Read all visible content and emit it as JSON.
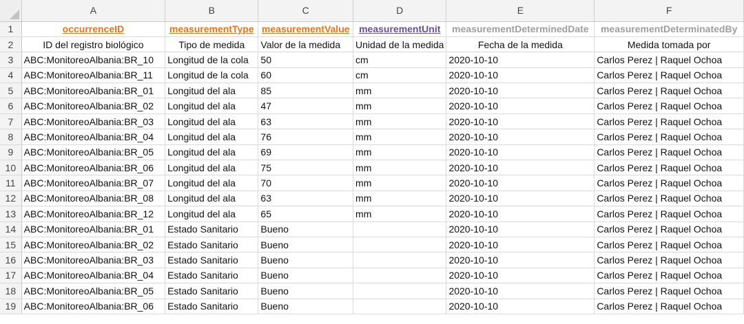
{
  "column_letters": [
    "A",
    "B",
    "C",
    "D",
    "E",
    "F"
  ],
  "header_row": {
    "row_number": "1",
    "cells": [
      {
        "text": "occurrenceID",
        "color": "#e3761f",
        "underline": true
      },
      {
        "text": "measurementType",
        "color": "#e3761f",
        "underline": true
      },
      {
        "text": "measurementValue",
        "color": "#e3761f",
        "underline": true
      },
      {
        "text": "measurementUnit",
        "color": "#6a4f94",
        "underline": true
      },
      {
        "text": "measurementDeterminedDate",
        "color": "#9e9e9e",
        "underline": false
      },
      {
        "text": "measurementDeterminatedBy",
        "color": "#9e9e9e",
        "underline": false
      }
    ]
  },
  "label_row": {
    "row_number": "2",
    "cells": [
      "ID del registro biológico",
      "Tipo de medida",
      "Valor de la medida",
      "Unidad de la medida",
      "Fecha de la medida",
      "Medida tomada por"
    ]
  },
  "rows": [
    {
      "n": "3",
      "cells": [
        "ABC:MonitoreoAlbania:BR_10",
        "Longitud de la cola",
        "50",
        "cm",
        "2020-10-10",
        "Carlos Perez | Raquel Ochoa"
      ]
    },
    {
      "n": "4",
      "cells": [
        "ABC:MonitoreoAlbania:BR_11",
        "Longitud de la cola",
        "60",
        "cm",
        "2020-10-10",
        "Carlos Perez | Raquel Ochoa"
      ]
    },
    {
      "n": "5",
      "cells": [
        "ABC:MonitoreoAlbania:BR_01",
        "Longitud del ala",
        "85",
        "mm",
        "2020-10-10",
        "Carlos Perez | Raquel Ochoa"
      ]
    },
    {
      "n": "6",
      "cells": [
        "ABC:MonitoreoAlbania:BR_02",
        "Longitud del ala",
        "47",
        "mm",
        "2020-10-10",
        "Carlos Perez | Raquel Ochoa"
      ]
    },
    {
      "n": "7",
      "cells": [
        "ABC:MonitoreoAlbania:BR_03",
        "Longitud del ala",
        "63",
        "mm",
        "2020-10-10",
        "Carlos Perez | Raquel Ochoa"
      ]
    },
    {
      "n": "8",
      "cells": [
        "ABC:MonitoreoAlbania:BR_04",
        "Longitud del ala",
        "76",
        "mm",
        "2020-10-10",
        "Carlos Perez | Raquel Ochoa"
      ]
    },
    {
      "n": "9",
      "cells": [
        "ABC:MonitoreoAlbania:BR_05",
        "Longitud del ala",
        "69",
        "mm",
        "2020-10-10",
        "Carlos Perez | Raquel Ochoa"
      ]
    },
    {
      "n": "10",
      "cells": [
        "ABC:MonitoreoAlbania:BR_06",
        "Longitud del ala",
        "75",
        "mm",
        "2020-10-10",
        "Carlos Perez | Raquel Ochoa"
      ]
    },
    {
      "n": "11",
      "cells": [
        "ABC:MonitoreoAlbania:BR_07",
        "Longitud del ala",
        "70",
        "mm",
        "2020-10-10",
        "Carlos Perez | Raquel Ochoa"
      ]
    },
    {
      "n": "12",
      "cells": [
        "ABC:MonitoreoAlbania:BR_08",
        "Longitud del ala",
        "63",
        "mm",
        "2020-10-10",
        "Carlos Perez | Raquel Ochoa"
      ]
    },
    {
      "n": "13",
      "cells": [
        "ABC:MonitoreoAlbania:BR_12",
        "Longitud del ala",
        "65",
        "mm",
        "2020-10-10",
        "Carlos Perez | Raquel Ochoa"
      ]
    },
    {
      "n": "14",
      "cells": [
        "ABC:MonitoreoAlbania:BR_01",
        "Estado Sanitario",
        "Bueno",
        "",
        "2020-10-10",
        "Carlos Perez | Raquel Ochoa"
      ]
    },
    {
      "n": "15",
      "cells": [
        "ABC:MonitoreoAlbania:BR_02",
        "Estado Sanitario",
        "Bueno",
        "",
        "2020-10-10",
        "Carlos Perez | Raquel Ochoa"
      ]
    },
    {
      "n": "16",
      "cells": [
        "ABC:MonitoreoAlbania:BR_03",
        "Estado Sanitario",
        "Bueno",
        "",
        "2020-10-10",
        "Carlos Perez | Raquel Ochoa"
      ]
    },
    {
      "n": "17",
      "cells": [
        "ABC:MonitoreoAlbania:BR_04",
        "Estado Sanitario",
        "Bueno",
        "",
        "2020-10-10",
        "Carlos Perez | Raquel Ochoa"
      ]
    },
    {
      "n": "18",
      "cells": [
        "ABC:MonitoreoAlbania:BR_05",
        "Estado Sanitario",
        "Bueno",
        "",
        "2020-10-10",
        "Carlos Perez | Raquel Ochoa"
      ]
    },
    {
      "n": "19",
      "cells": [
        "ABC:MonitoreoAlbania:BR_06",
        "Estado Sanitario",
        "Bueno",
        "",
        "2020-10-10",
        "Carlos Perez | Raquel Ochoa"
      ]
    }
  ]
}
